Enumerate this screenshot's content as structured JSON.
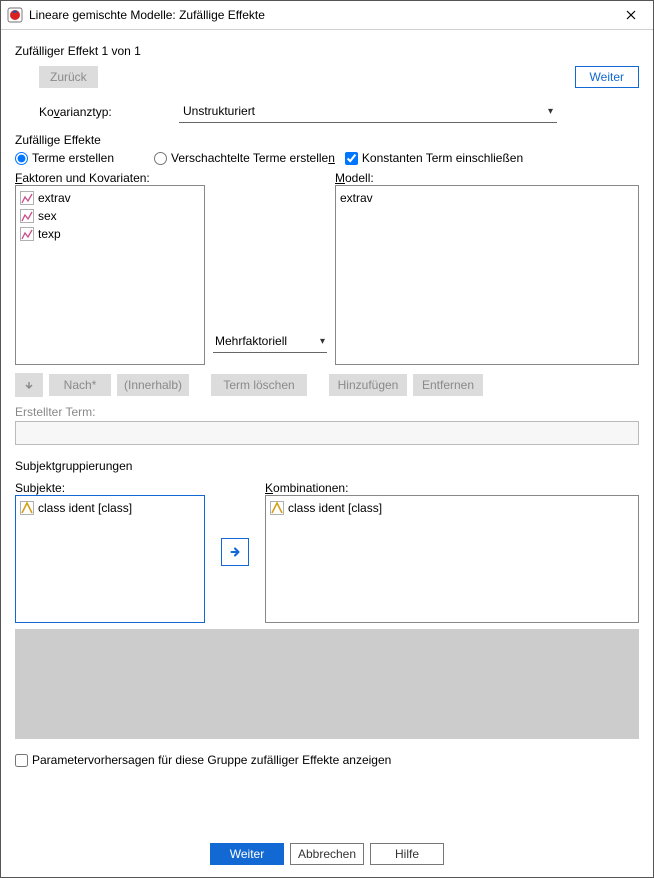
{
  "window": {
    "title": "Lineare gemischte Modelle: Zufällige Effekte"
  },
  "header": {
    "counter": "Zufälliger Effekt 1 von 1",
    "back": "Zurück",
    "next": "Weiter"
  },
  "covariance": {
    "label_pre": "Ko",
    "label_u": "v",
    "label_post": "arianztyp:",
    "value": "Unstrukturiert"
  },
  "random_effects": {
    "section": "Zufällige Effekte",
    "radio_build": "Terme erstellen",
    "radio_nested_pre": "Verschachtelte Terme erstelle",
    "radio_nested_u": "n",
    "include_const": "Konstanten Term einschließen"
  },
  "factors": {
    "label_u": "F",
    "label_post": "aktoren und Kovariaten:",
    "items": [
      "extrav",
      "sex",
      "texp"
    ]
  },
  "model": {
    "label_u": "M",
    "label_post": "odell:",
    "items": [
      "extrav"
    ]
  },
  "interaction": {
    "value": "Mehrfaktoriell"
  },
  "buildbar": {
    "nest": "Nach*",
    "within": "(Innerhalb)",
    "clear": "Term löschen",
    "add": "Hinzufügen",
    "remove": "Entfernen",
    "built_label": "Erstellter Term:"
  },
  "subjects": {
    "section": "Subjektgruppierungen",
    "subjects_label": "Subjekte:",
    "comb_label_u": "K",
    "comb_label_post": "ombinationen:",
    "items": [
      "class ident [class]"
    ],
    "comb_items": [
      "class ident [class]"
    ]
  },
  "predict_chk": "Parametervorhersagen für diese Gruppe zufälliger Effekte anzeigen",
  "footer": {
    "continue": "Weiter",
    "cancel": "Abbrechen",
    "help": "Hilfe"
  }
}
